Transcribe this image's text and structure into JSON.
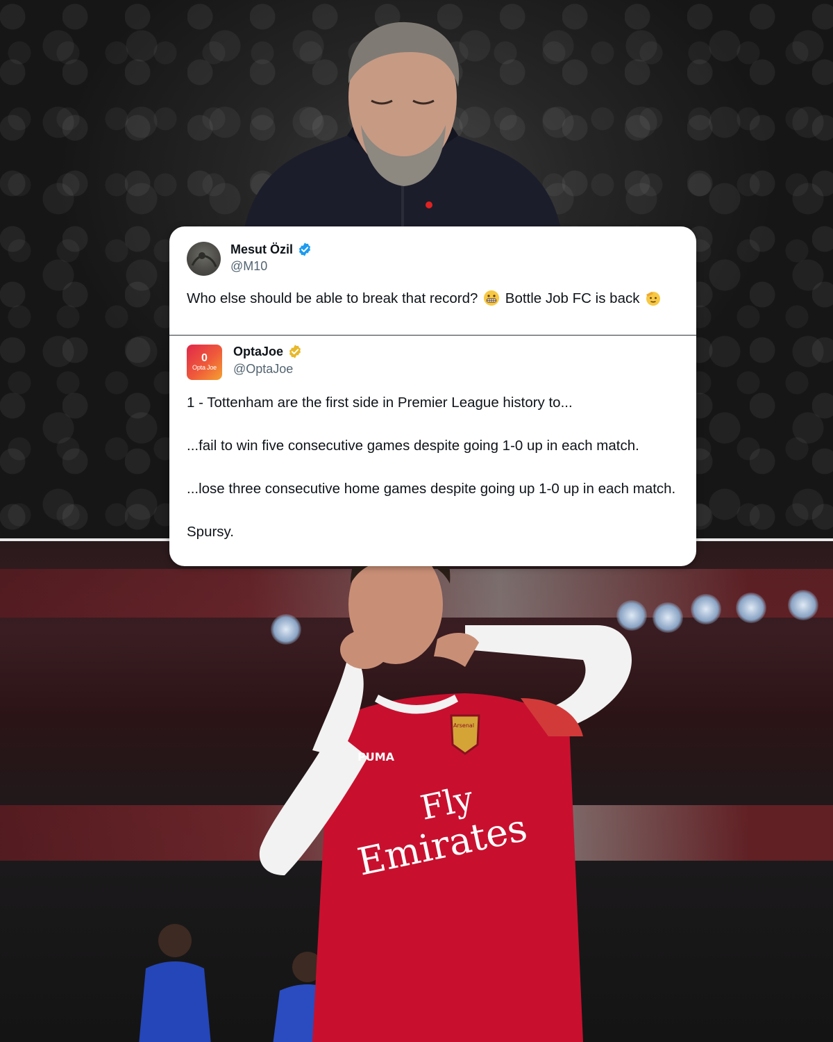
{
  "top_photo": {
    "subject_icon": "coach-looking-down"
  },
  "bottom_photo": {
    "subject_icon": "player-celebration"
  },
  "tweet": {
    "author_name": "Mesut Özil",
    "author_handle": "@M10",
    "verified_badge_color": "#1d9bf0",
    "text_part1": "Who else should be able to break that record?",
    "emoji1_icon": "grimacing-face-emoji",
    "text_part2": "Bottle Job FC is back",
    "emoji2_icon": "saluting-face-emoji"
  },
  "quoted_tweet": {
    "author_name": "OptaJoe",
    "author_handle": "@OptaJoe",
    "verified_badge_color": "#e8b829",
    "avatar_zero": "0",
    "avatar_word": "Opta Joe",
    "lines": [
      "1 - Tottenham are the first side in Premier League history to...",
      "...fail to win five consecutive games despite going 1-0 up in each match.",
      "...lose three consecutive home games despite going up 1-0 up in each match.",
      "Spursy."
    ]
  },
  "jersey": {
    "sponsor_line1": "Fly",
    "sponsor_line2": "Emirates",
    "kit_brand": "PUMA",
    "crest_text": "Arsenal",
    "colors": {
      "red": "#c8102e",
      "sleeve": "#f2f2f2"
    }
  }
}
